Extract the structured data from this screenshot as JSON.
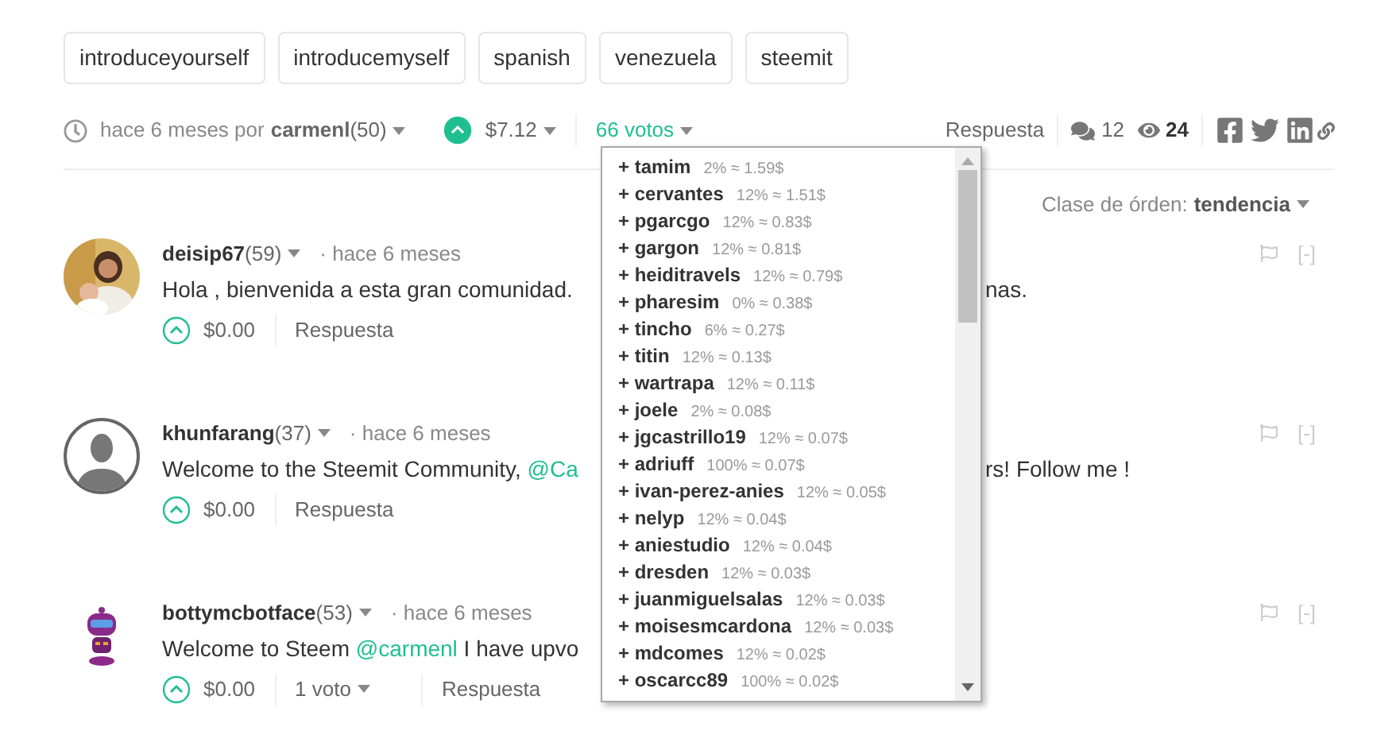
{
  "tags": [
    "introduceyourself",
    "introducemyself",
    "spanish",
    "venezuela",
    "steemit"
  ],
  "post_meta": {
    "time": "hace 6 meses por",
    "author": "carmenl",
    "reputation": "(50)",
    "upvoted": true,
    "payout": "$7.12",
    "votes": "66 votos",
    "reply": "Respuesta",
    "comments": "12",
    "views": "24"
  },
  "sort": {
    "label": "Clase de órden:",
    "value": "tendencia"
  },
  "comments": [
    {
      "author": "deisip67",
      "reputation": "(59)",
      "time": "· hace 6 meses",
      "body_left": [
        {
          "kind": "text",
          "text": "Hola , bienvenida a esta gran comunidad."
        }
      ],
      "body_right": "nas.",
      "payout": "$0.00",
      "reply": "Respuesta",
      "collapse": "[-]"
    },
    {
      "kind": "silhouette",
      "author": "khunfarang",
      "reputation": "(37)",
      "time": "· hace 6 meses",
      "body_left": [
        {
          "kind": "text",
          "text": "Welcome to the Steemit Community, "
        },
        {
          "kind": "mention",
          "text": "@Ca"
        }
      ],
      "body_right": "rs! Follow me !",
      "payout": "$0.00",
      "reply": "Respuesta",
      "collapse": "[-]"
    },
    {
      "kind": "robot",
      "author": "bottymcbotface",
      "reputation": "(53)",
      "time": "· hace 6 meses",
      "body_left": [
        {
          "kind": "text",
          "text": "Welcome to Steem "
        },
        {
          "kind": "mention",
          "text": "@carmenl"
        },
        {
          "kind": "text",
          "text": " I have upvo"
        }
      ],
      "payout": "$0.00",
      "votes": "1 voto",
      "reply": "Respuesta",
      "collapse": "[-]"
    }
  ],
  "voters": [
    {
      "name": "+ tamim",
      "detail": "2% ≈ 1.59$"
    },
    {
      "name": "+ cervantes",
      "detail": "12% ≈ 1.51$"
    },
    {
      "name": "+ pgarcgo",
      "detail": "12% ≈ 0.83$"
    },
    {
      "name": "+ gargon",
      "detail": "12% ≈ 0.81$"
    },
    {
      "name": "+ heiditravels",
      "detail": "12% ≈ 0.79$"
    },
    {
      "name": "+ pharesim",
      "detail": "0% ≈ 0.38$"
    },
    {
      "name": "+ tincho",
      "detail": "6% ≈ 0.27$"
    },
    {
      "name": "+ titin",
      "detail": "12% ≈ 0.13$"
    },
    {
      "name": "+ wartrapa",
      "detail": "12% ≈ 0.11$"
    },
    {
      "name": "+ joele",
      "detail": "2% ≈ 0.08$"
    },
    {
      "name": "+ jgcastrillo19",
      "detail": "12% ≈ 0.07$"
    },
    {
      "name": "+ adriuff",
      "detail": "100% ≈ 0.07$"
    },
    {
      "name": "+ ivan-perez-anies",
      "detail": "12% ≈ 0.05$"
    },
    {
      "name": "+ nelyp",
      "detail": "12% ≈ 0.04$"
    },
    {
      "name": "+ aniestudio",
      "detail": "12% ≈ 0.04$"
    },
    {
      "name": "+ dresden",
      "detail": "12% ≈ 0.03$"
    },
    {
      "name": "+ juanmiguelsalas",
      "detail": "12% ≈ 0.03$"
    },
    {
      "name": "+ moisesmcardona",
      "detail": "12% ≈ 0.03$"
    },
    {
      "name": "+ mdcomes",
      "detail": "12% ≈ 0.02$"
    },
    {
      "name": "+ oscarcc89",
      "detail": "100% ≈ 0.02$"
    }
  ]
}
